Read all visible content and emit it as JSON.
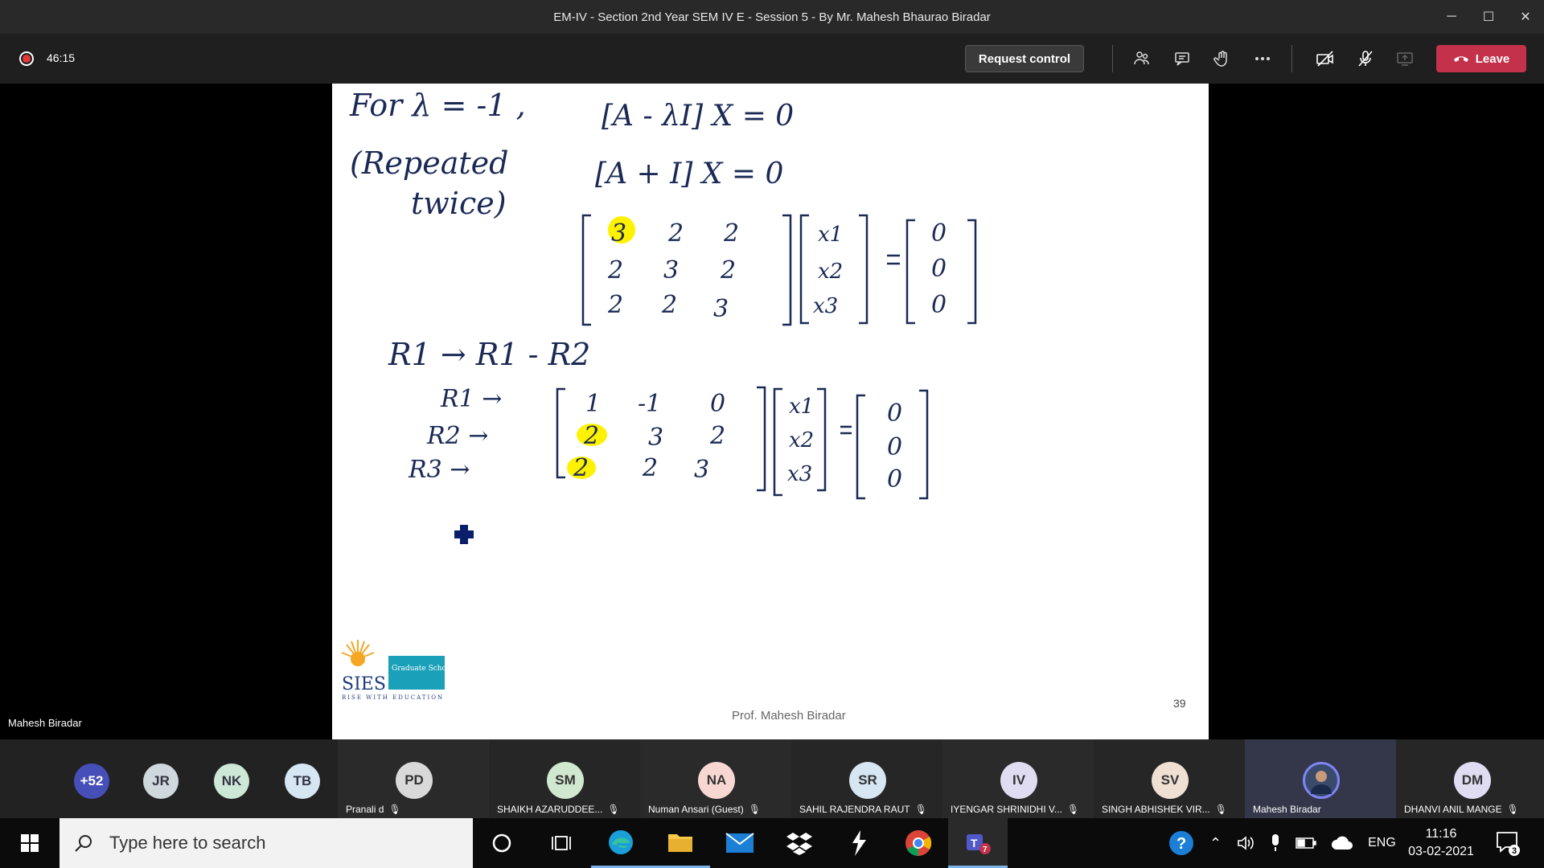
{
  "window": {
    "title": "EM-IV - Section 2nd Year SEM IV E - Session 5 - By Mr. Mahesh Bhaurao Biradar",
    "minimize": "─",
    "maximize": "☐",
    "close": "✕"
  },
  "toolbar": {
    "elapsed": "46:15",
    "request_control": "Request control",
    "leave": "Leave"
  },
  "slide": {
    "presenter": "Mahesh Biradar",
    "footer": "Prof. Mahesh Biradar",
    "page": "39",
    "logo_text": "SIES",
    "logo_tagline": "RISE WITH EDUCATION",
    "logo_school": "Graduate School of Technology",
    "handwriting": {
      "line1_left": "For λ = -1 ,",
      "line2_left": "(Repeated",
      "line3_left": "twice)",
      "eq1": "[A - λI] X = 0",
      "eq2": "[A + I] X = 0",
      "matrix1": [
        [
          "3",
          "2",
          "2"
        ],
        [
          "2",
          "3",
          "2"
        ],
        [
          "2",
          "2",
          "3"
        ]
      ],
      "vars1": [
        "x1",
        "x2",
        "x3"
      ],
      "zeros1": [
        "0",
        "0",
        "0"
      ],
      "op": "R1 → R1 - R2",
      "row_labels": [
        "R1 →",
        "R2 →",
        "R3 →"
      ],
      "matrix2": [
        [
          "1",
          "-1",
          "0"
        ],
        [
          "2",
          "3",
          "2"
        ],
        [
          "2",
          "2",
          "3"
        ]
      ],
      "vars2": [
        "x1",
        "x2",
        "x3"
      ],
      "zeros2": [
        "0",
        "0",
        "0"
      ]
    }
  },
  "participants": {
    "overflow": "+52",
    "chips": [
      "JR",
      "NK",
      "TB"
    ],
    "tiles": [
      {
        "initials": "PD",
        "name": "Pranali d",
        "color": "#d9d9d9"
      },
      {
        "initials": "SM",
        "name": "SHAIKH AZARUDDEE...",
        "color": "#cfe8cf"
      },
      {
        "initials": "NA",
        "name": "Numan Ansari (Guest)",
        "color": "#f8d7d2"
      },
      {
        "initials": "SR",
        "name": "SAHIL RAJENDRA RAUT",
        "color": "#d6e6f2"
      },
      {
        "initials": "IV",
        "name": "IYENGAR SHRINIDHI V...",
        "color": "#e0dcf2"
      },
      {
        "initials": "SV",
        "name": "SINGH ABHISHEK VIR...",
        "color": "#f0e0d4"
      },
      {
        "initials": "",
        "name": "Mahesh Biradar",
        "color": "#394a6b"
      },
      {
        "initials": "DM",
        "name": "DHANVI ANIL MANGE",
        "color": "#e0dcf2"
      }
    ]
  },
  "taskbar": {
    "search_placeholder": "Type here to search",
    "language": "ENG",
    "time": "11:16",
    "date": "03-02-2021",
    "notifications": "3",
    "teams_badge": "7"
  }
}
